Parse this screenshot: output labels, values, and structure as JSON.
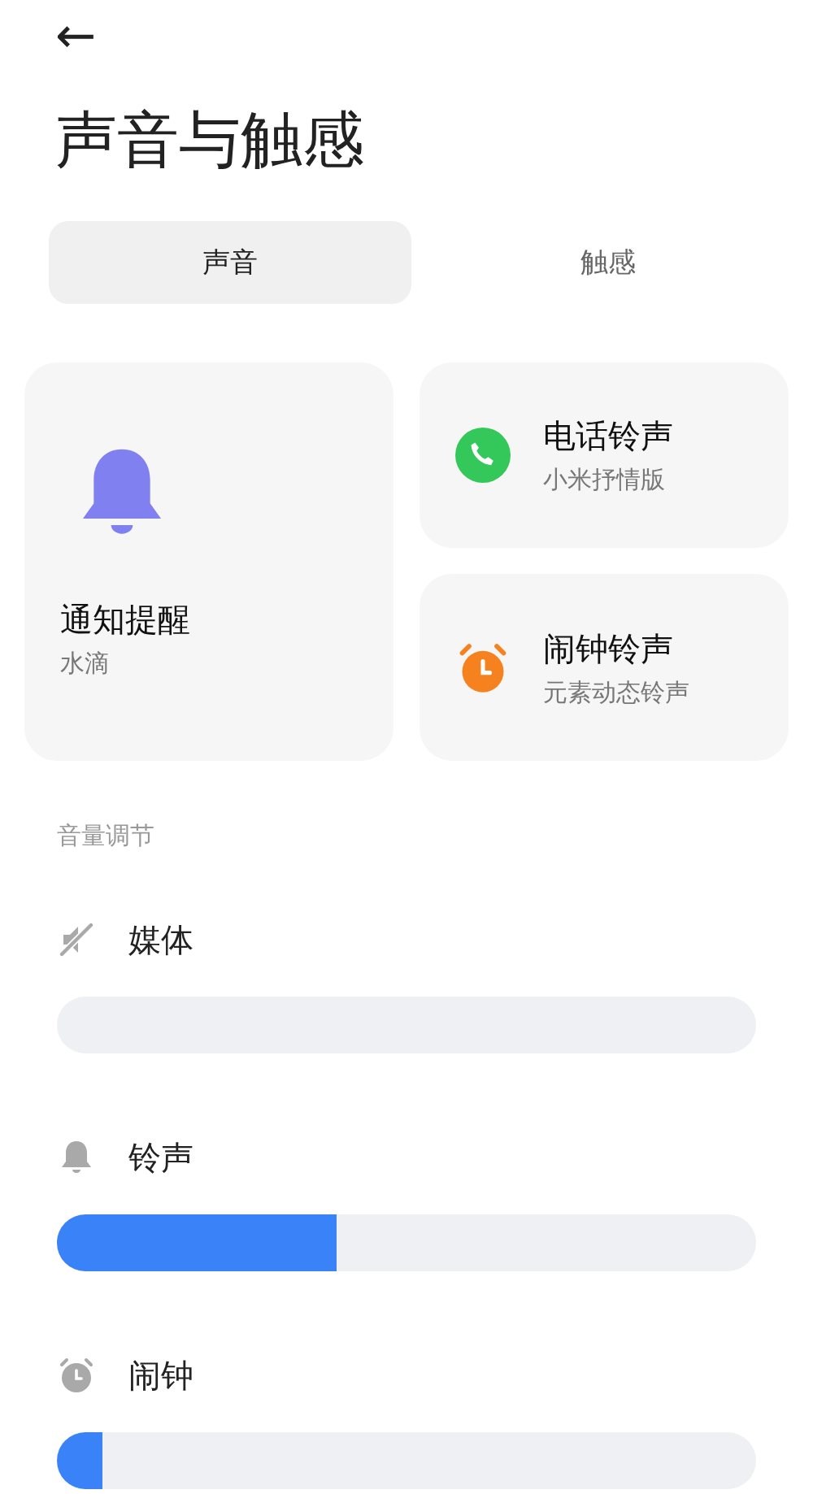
{
  "header": {
    "back": "←",
    "title": "声音与触感"
  },
  "tabs": [
    {
      "label": "声音",
      "selected": true
    },
    {
      "label": "触感",
      "selected": false
    }
  ],
  "cards": [
    {
      "kind": "notification",
      "title": "通知提醒",
      "subtitle": "水滴"
    },
    {
      "kind": "phone",
      "title": "电话铃声",
      "subtitle": "小米抒情版"
    },
    {
      "kind": "alarm",
      "title": "闹钟铃声",
      "subtitle": "元素动态铃声"
    }
  ],
  "volume": {
    "heading": "音量调节",
    "rows": [
      {
        "kind": "media",
        "label": "媒体",
        "muted": true
      },
      {
        "kind": "ring",
        "label": "铃声",
        "muted": false,
        "level": 0.4
      },
      {
        "kind": "alarm",
        "label": "闹钟",
        "muted": false,
        "level": 0.065
      }
    ]
  }
}
